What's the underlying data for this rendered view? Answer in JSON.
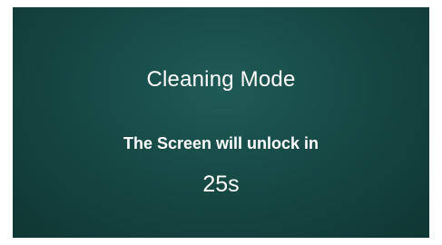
{
  "screen": {
    "title": "Cleaning Mode",
    "message": "The Screen will unlock in",
    "countdown": "25s",
    "background_color": "#174945",
    "text_color": "#ffffff"
  }
}
